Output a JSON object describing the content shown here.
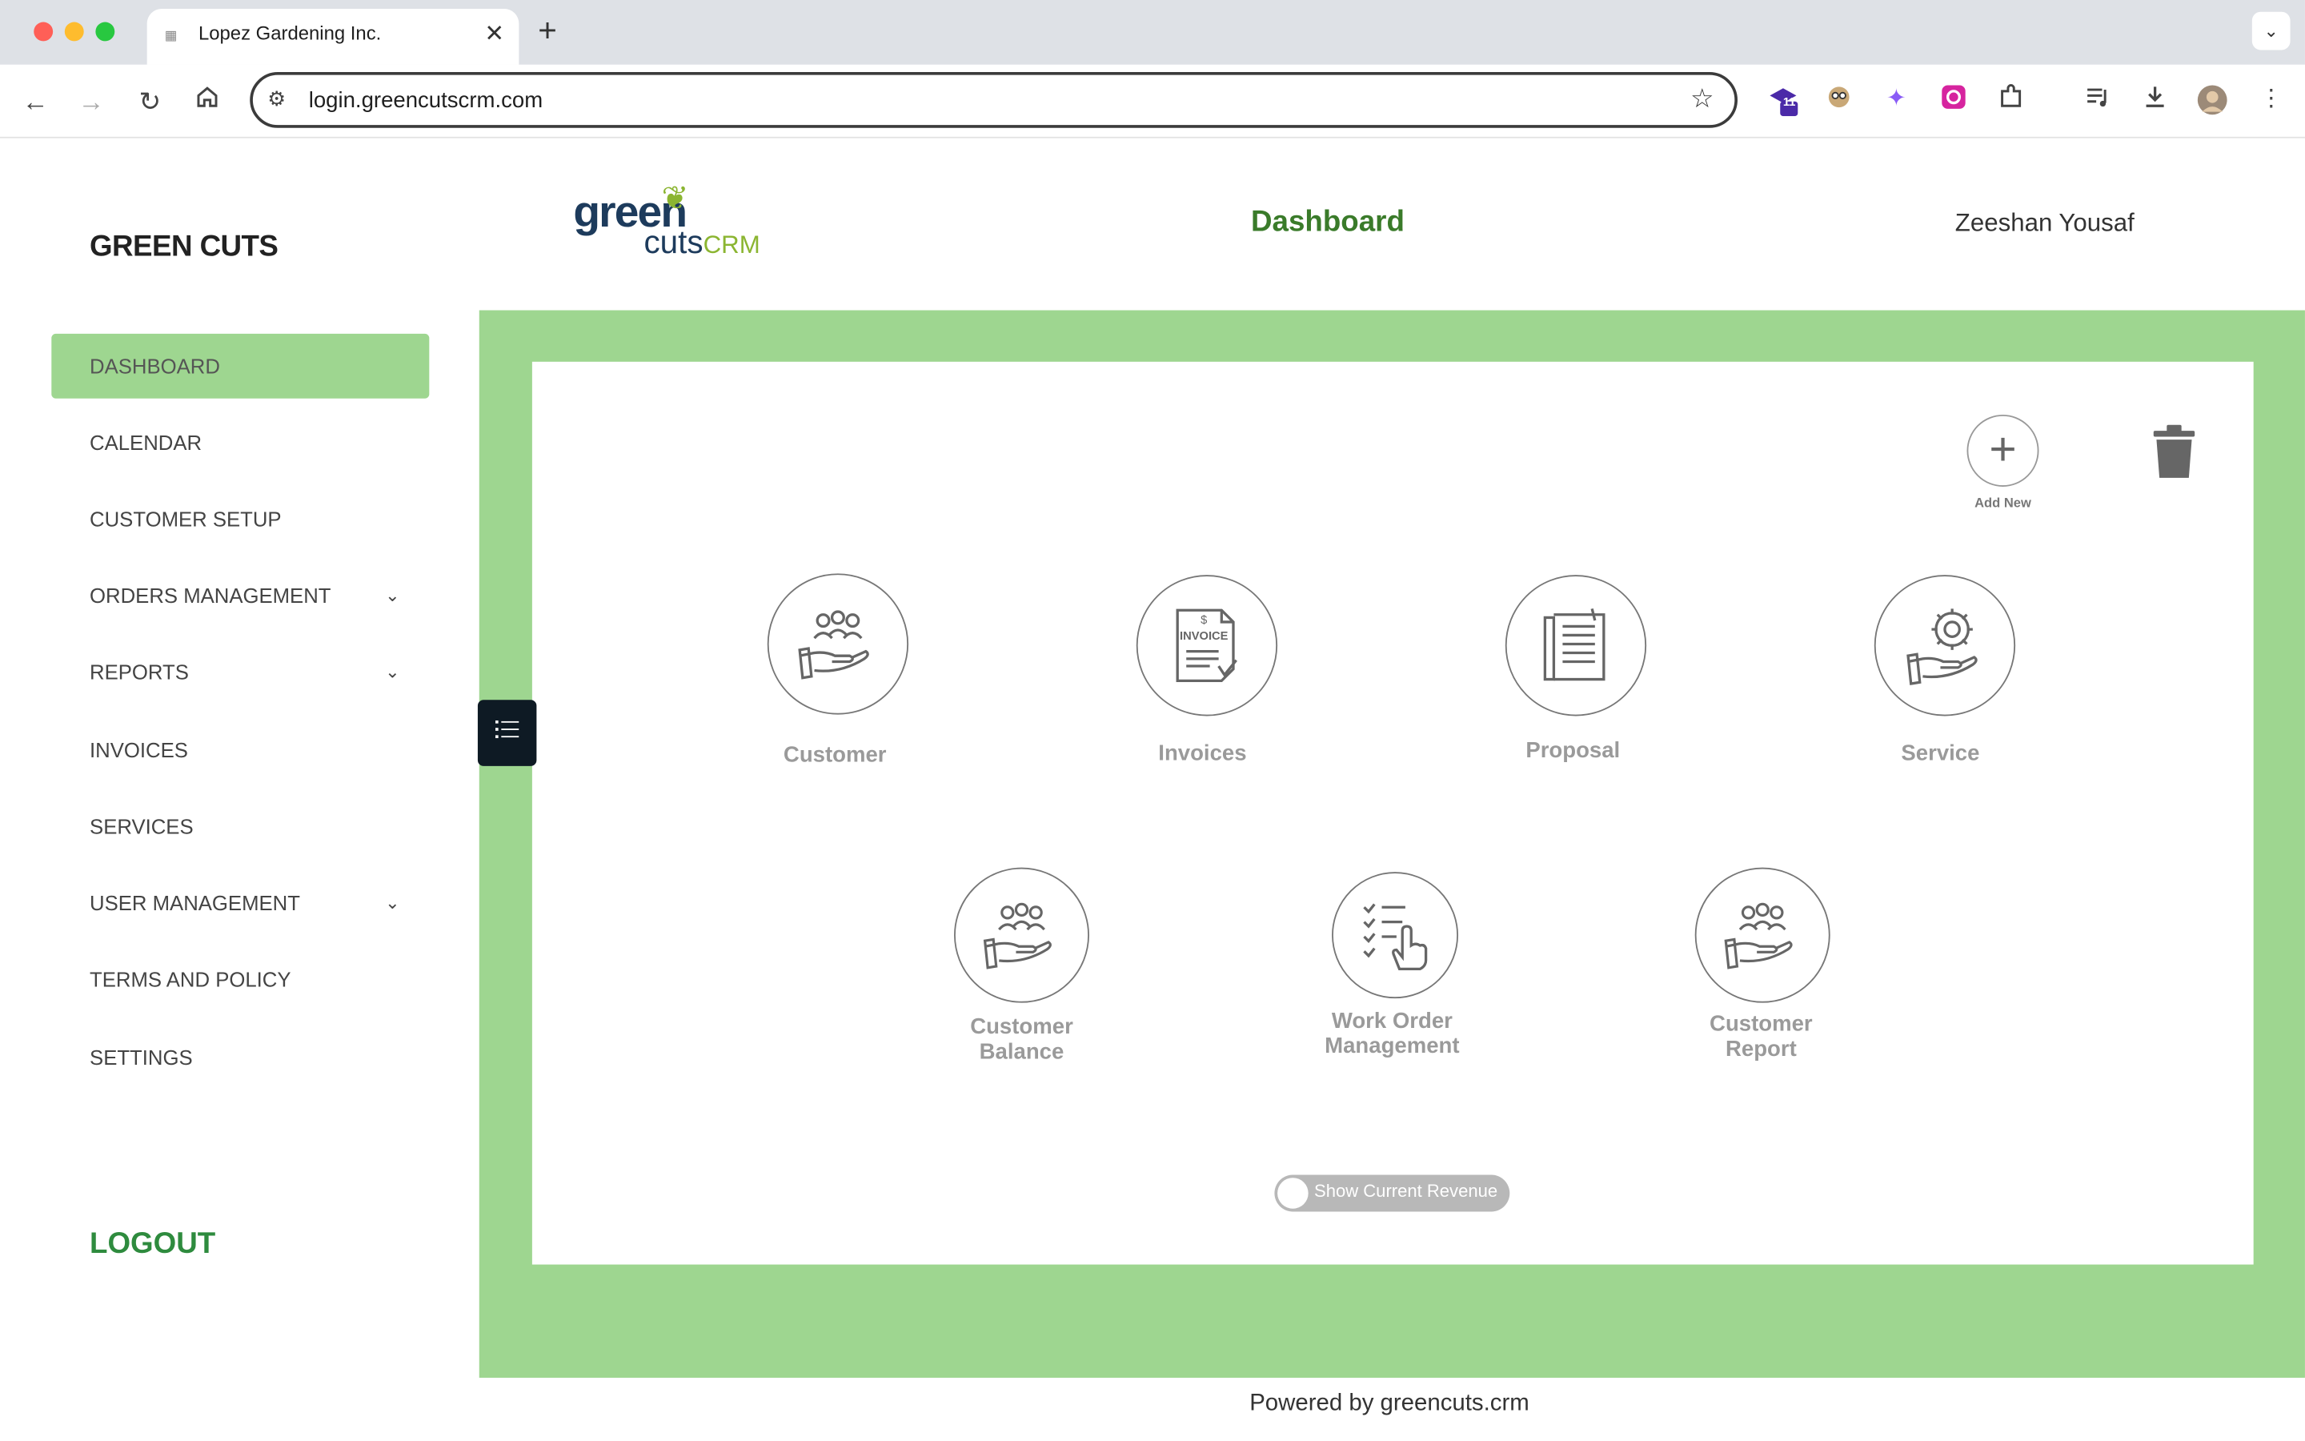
{
  "browser": {
    "tab_title": "Lopez Gardening Inc.",
    "url": "login.greencutscrm.com",
    "extension_badge": "11"
  },
  "sidebar": {
    "brand": "GREEN CUTS",
    "items": [
      {
        "label": "DASHBOARD"
      },
      {
        "label": "CALENDAR"
      },
      {
        "label": "CUSTOMER SETUP"
      },
      {
        "label": "ORDERS MANAGEMENT"
      },
      {
        "label": "REPORTS"
      },
      {
        "label": "INVOICES"
      },
      {
        "label": "SERVICES"
      },
      {
        "label": "USER MANAGEMENT"
      },
      {
        "label": "TERMS AND POLICY"
      },
      {
        "label": "SETTINGS"
      }
    ],
    "logout": "LOGOUT"
  },
  "header": {
    "logo_green": "green",
    "logo_cuts": "cuts",
    "logo_crm": "CRM",
    "title": "Dashboard",
    "user": "Zeeshan Yousaf"
  },
  "actions": {
    "add_new": "Add New"
  },
  "tiles": [
    {
      "label": "Customer"
    },
    {
      "label": "Invoices"
    },
    {
      "label": "Proposal"
    },
    {
      "label": "Service"
    },
    {
      "label": "Customer Balance"
    },
    {
      "label": "Work Order Management"
    },
    {
      "label": "Customer Report"
    }
  ],
  "invoice_icon_text": "INVOICE",
  "revenue_toggle": "Show Current Revenue",
  "footer": "Powered by greencuts.crm",
  "colors": {
    "accent_green": "#9ed690",
    "title_green": "#3a7b2a",
    "logout_green": "#2e8b3e"
  }
}
